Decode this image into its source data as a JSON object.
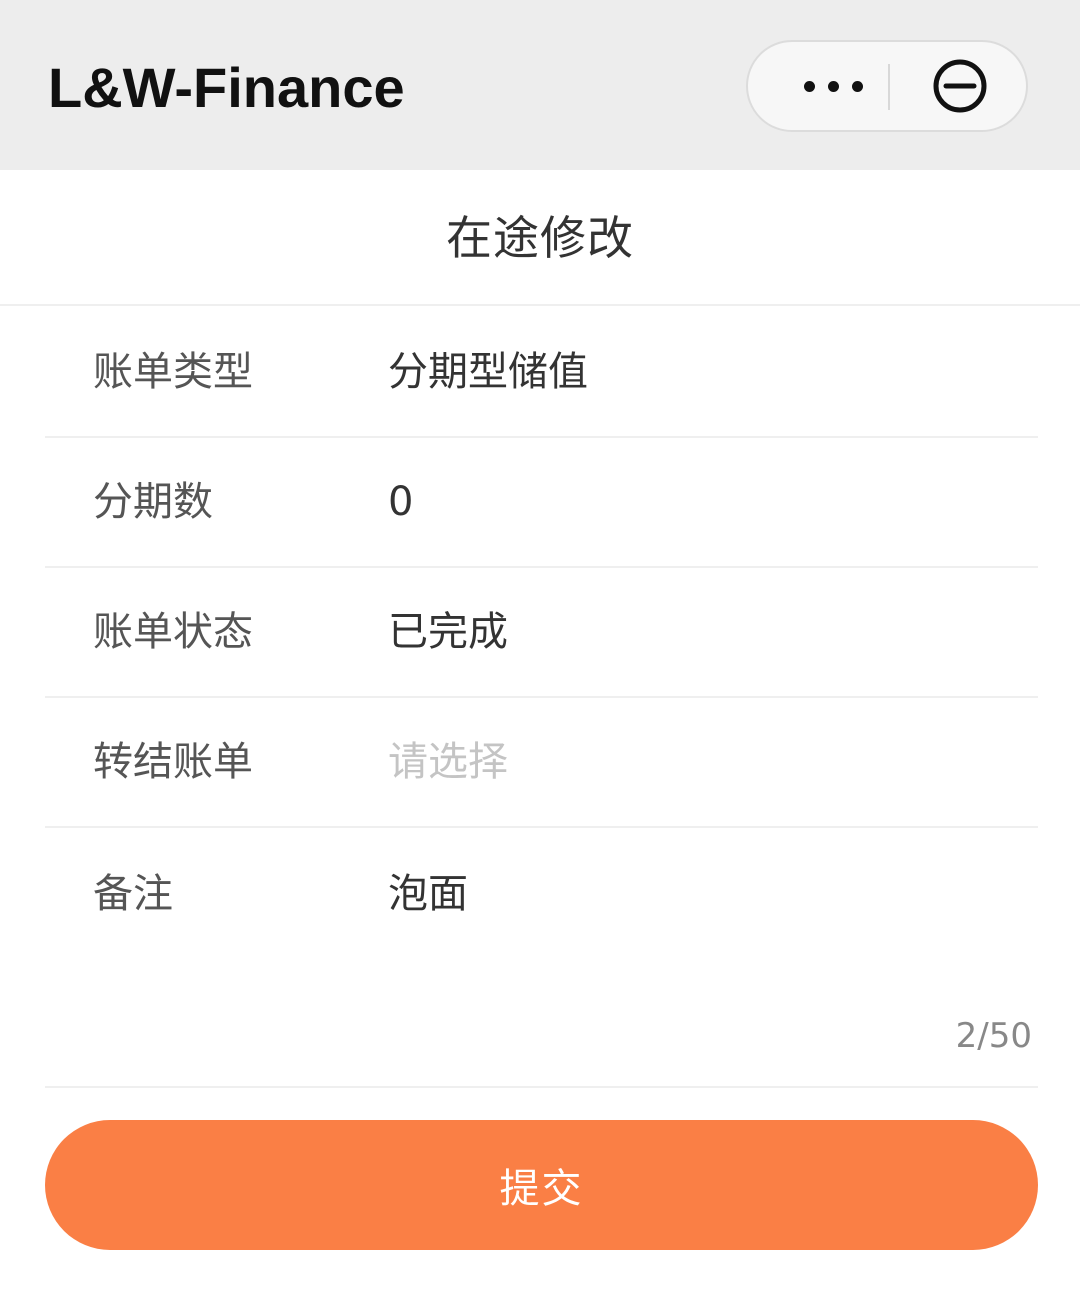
{
  "app": {
    "title": "L&W-Finance"
  },
  "capsule": {
    "more_icon": "more-dots-icon",
    "close_icon": "circle-minus-icon"
  },
  "page": {
    "title": "在途修改"
  },
  "form": {
    "rows": [
      {
        "label": "账单类型",
        "value": "分期型储值"
      },
      {
        "label": "分期数",
        "value": "0"
      },
      {
        "label": "账单状态",
        "value": "已完成"
      },
      {
        "label": "转结账单",
        "placeholder": "请选择"
      },
      {
        "label": "备注",
        "value": "泡面"
      }
    ],
    "remark_counter": "2/50"
  },
  "submit": {
    "label": "提交"
  },
  "colors": {
    "accent": "#fa7f45",
    "topbar": "#ededed"
  }
}
